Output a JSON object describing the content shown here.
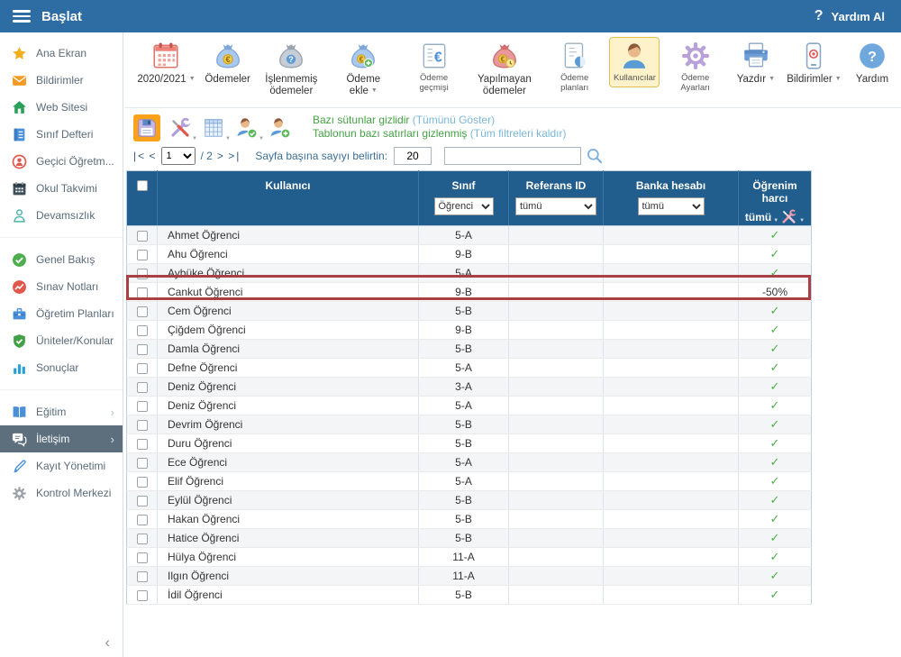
{
  "topbar": {
    "menu_label": "Başlat",
    "help_glyph": "?",
    "help_label": "Yardım Al"
  },
  "sidebar": {
    "items": [
      {
        "label": "Ana Ekran"
      },
      {
        "label": "Bildirimler"
      },
      {
        "label": "Web Sitesi"
      },
      {
        "label": "Sınıf Defteri"
      },
      {
        "label": "Geçici Öğretm..."
      },
      {
        "label": "Okul Takvimi"
      },
      {
        "label": "Devamsızlık"
      },
      {
        "label": "Genel Bakış"
      },
      {
        "label": "Sınav Notları"
      },
      {
        "label": "Öğretim Planları"
      },
      {
        "label": "Üniteler/Konular"
      },
      {
        "label": "Sonuçlar"
      },
      {
        "label": "Eğitim"
      },
      {
        "label": "İletişim"
      },
      {
        "label": "Kayıt Yönetimi"
      },
      {
        "label": "Kontrol Merkezi"
      }
    ],
    "collapse_glyph": "‹"
  },
  "toolbar": {
    "items": [
      {
        "label": "2020/2021",
        "caret": true
      },
      {
        "label": "Ödemeler"
      },
      {
        "label": "İşlenmemiş ödemeler"
      },
      {
        "label": "Ödeme ekle",
        "caret": true
      },
      {
        "label": "Ödeme geçmişi"
      },
      {
        "label": "Yapılmayan ödemeler"
      },
      {
        "label": "Ödeme planları"
      },
      {
        "label": "Kullanıcılar",
        "active": true
      },
      {
        "label": "Ödeme Ayarları"
      },
      {
        "label": "Yazdır",
        "caret": true
      },
      {
        "label": "Bildirimler",
        "caret": true
      },
      {
        "label": "Yardım"
      }
    ]
  },
  "table_toolbar": {
    "hint1_text": "Bazı sütunlar gizlidir",
    "hint1_link": "(Tümünü Göster)",
    "hint2_text": "Tablonun bazı satırları gizlenmiş",
    "hint2_link": "(Tüm filtreleri kaldır)"
  },
  "pagination": {
    "first": "|<",
    "prev": "<",
    "page": "1",
    "of": "/ 2",
    "next": ">",
    "last": ">|",
    "size_label": "Sayfa başına sayıyı belirtin:",
    "page_size": "20",
    "search_value": ""
  },
  "table": {
    "columns": {
      "user": "Kullanıcı",
      "class": "Sınıf",
      "reference": "Referans ID",
      "bank": "Banka hesabı",
      "fee": "Öğrenim harcı"
    },
    "filters": {
      "class": "Öğrenci",
      "reference": "tümü",
      "bank": "tümü",
      "fee": "tümü"
    },
    "rows": [
      {
        "name": "Ahmet Öğrenci",
        "class": "5-A",
        "fee": "✓"
      },
      {
        "name": "Ahu Öğrenci",
        "class": "9-B",
        "fee": "✓"
      },
      {
        "name": "Aybüke Öğrenci",
        "class": "5-A",
        "fee": "✓"
      },
      {
        "name": "Cankut Öğrenci",
        "class": "9-B",
        "fee": "-50%",
        "highlighted": true
      },
      {
        "name": "Cem Öğrenci",
        "class": "5-B",
        "fee": "✓"
      },
      {
        "name": "Çiğdem Öğrenci",
        "class": "9-B",
        "fee": "✓"
      },
      {
        "name": "Damla Öğrenci",
        "class": "5-B",
        "fee": "✓"
      },
      {
        "name": "Defne Öğrenci",
        "class": "5-A",
        "fee": "✓"
      },
      {
        "name": "Deniz Öğrenci",
        "class": "3-A",
        "fee": "✓"
      },
      {
        "name": "Deniz Öğrenci",
        "class": "5-A",
        "fee": "✓"
      },
      {
        "name": "Devrim Öğrenci",
        "class": "5-B",
        "fee": "✓"
      },
      {
        "name": "Duru Öğrenci",
        "class": "5-B",
        "fee": "✓"
      },
      {
        "name": "Ece Öğrenci",
        "class": "5-A",
        "fee": "✓"
      },
      {
        "name": "Elif Öğrenci",
        "class": "5-A",
        "fee": "✓"
      },
      {
        "name": "Eylül Öğrenci",
        "class": "5-B",
        "fee": "✓"
      },
      {
        "name": "Hakan Öğrenci",
        "class": "5-B",
        "fee": "✓"
      },
      {
        "name": "Hatice Öğrenci",
        "class": "5-B",
        "fee": "✓"
      },
      {
        "name": "Hülya Öğrenci",
        "class": "11-A",
        "fee": "✓"
      },
      {
        "name": "Ilgın Öğrenci",
        "class": "11-A",
        "fee": "✓"
      },
      {
        "name": "İdil Öğrenci",
        "class": "5-B",
        "fee": "✓"
      }
    ]
  },
  "colors": {
    "topbar_bg": "#2d6da3",
    "table_header_bg": "#225e8d",
    "active_nav_bg": "#5d6e7d",
    "highlight_border": "#a94043",
    "check_green": "#4cae4c",
    "save_highlight_bg": "#f9a21a",
    "active_tool_bg": "#fdf2c9",
    "active_tool_border": "#e2bf56",
    "hint_green": "#44a244",
    "hint_link_blue": "#7ab7d9"
  },
  "icons": {
    "hamburger-icon": "three bars",
    "help-icon": "?",
    "star-icon": "★",
    "envelope-icon": "✉",
    "house-icon": "⌂",
    "notebook-icon": "book",
    "person-circle-icon": "person in circle",
    "calendar-icon": "calendar grid",
    "person-outline-icon": "person outline",
    "check-circle-icon": "✓ in circle",
    "grades-icon": "line chart in circle",
    "briefcase-icon": "briefcase",
    "shield-check-icon": "shield ✓",
    "bar-chart-icon": "bars",
    "book-icon": "open book",
    "chat-icon": "speech bubbles",
    "pen-icon": "pen",
    "gear-icon": "gear",
    "money-bag-icon": "money bag €",
    "printer-icon": "printer",
    "phone-icon": "phone",
    "save-icon": "floppy disk",
    "tools-icon": "wrench + screwdriver",
    "table-grid-icon": "grid",
    "search-icon": "magnifier",
    "caret-down-icon": "▼"
  }
}
